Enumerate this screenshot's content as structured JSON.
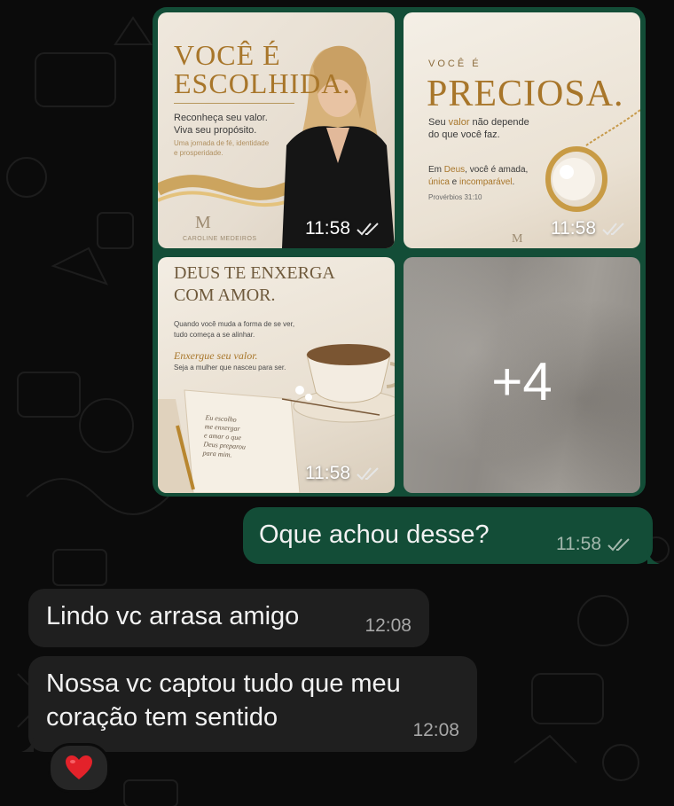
{
  "chat": {
    "media": {
      "tiles": [
        {
          "title_lines": [
            "VOCÊ É",
            "ESCOLHIDA."
          ],
          "subtitle_lines": [
            "Reconheça seu valor.",
            "Viva seu propósito."
          ],
          "small_lines": [
            "Uma jornada de fé, identidade",
            "e prosperidade."
          ],
          "brand": "CAROLINE MEDEIROS",
          "time": "11:58"
        },
        {
          "kicker": "VOCÊ É",
          "title": "PRECIOSA.",
          "line1_pre": "Seu ",
          "line1_em": "valor",
          "line1_post": " não depende",
          "line2": "do que você faz.",
          "line3_pre": "Em ",
          "line3_em": "Deus",
          "line3_post": ", você é amada,",
          "line4_pre": "",
          "line4_em": "única",
          "line4_mid": " e ",
          "line4_em2": "incomparável",
          "line4_post": ".",
          "reference": "Provérbios 31:10",
          "time": "11:58"
        },
        {
          "title_lines": [
            "DEUS TE ENXERGA",
            "COM AMOR."
          ],
          "body_lines": [
            "Quando você muda a forma de se ver,",
            "tudo começa a se alinhar."
          ],
          "script_line": "Enxergue seu valor.",
          "body_line3": "Seja a mulher que nasceu para ser.",
          "handwriting": [
            "Eu escolho",
            "me enxergar",
            "e amar o que",
            "Deus preparou",
            "para mim."
          ],
          "time": "11:58"
        },
        {
          "overlay": "+4"
        }
      ]
    },
    "outgoing": {
      "text": "Oque achou desse?",
      "time": "11:58"
    },
    "incoming": [
      {
        "text": "Lindo vc arrasa amigo",
        "time": "12:08"
      },
      {
        "text_lines": [
          "Nossa vc captou tudo que meu",
          "coração tem sentido"
        ],
        "time": "12:08"
      }
    ],
    "reaction": "❤️"
  },
  "colors": {
    "outgoing_bubble": "#134d37",
    "incoming_bubble": "#1f1f1f",
    "gold": "#a8762a"
  }
}
